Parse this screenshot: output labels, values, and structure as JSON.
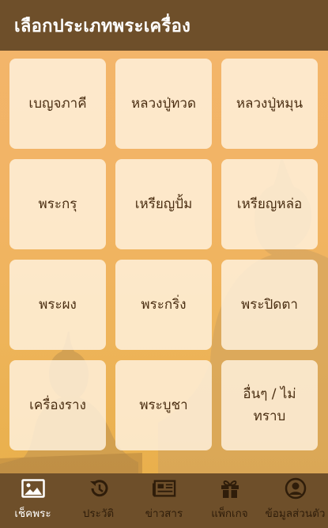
{
  "header": {
    "title": "เลือกประเภทพระเครื่อง"
  },
  "categories": [
    {
      "label": "เบญจภาคี"
    },
    {
      "label": "หลวงปู่ทวด"
    },
    {
      "label": "หลวงปู่หมุน"
    },
    {
      "label": "พระกรุ"
    },
    {
      "label": "เหรียญปั้ม"
    },
    {
      "label": "เหรียญหล่อ"
    },
    {
      "label": "พระผง"
    },
    {
      "label": "พระกริ่ง"
    },
    {
      "label": "พระปิดตา"
    },
    {
      "label": "เครื่องราง"
    },
    {
      "label": "พระบูชา"
    },
    {
      "label": "อื่นๆ / ไม่ทราบ"
    }
  ],
  "tabs": [
    {
      "label": "เช็คพระ",
      "icon": "image-icon",
      "active": true
    },
    {
      "label": "ประวัติ",
      "icon": "history-icon",
      "active": false
    },
    {
      "label": "ข่าวสาร",
      "icon": "newspaper-icon",
      "active": false
    },
    {
      "label": "แพ็กเกจ",
      "icon": "gift-icon",
      "active": false
    },
    {
      "label": "ข้อมูลส่วนตัว",
      "icon": "user-icon",
      "active": false
    }
  ],
  "colors": {
    "bar": "#6e4f2a",
    "background": "#f2b464",
    "card": "#fff3e1",
    "text": "#4a2e12"
  }
}
